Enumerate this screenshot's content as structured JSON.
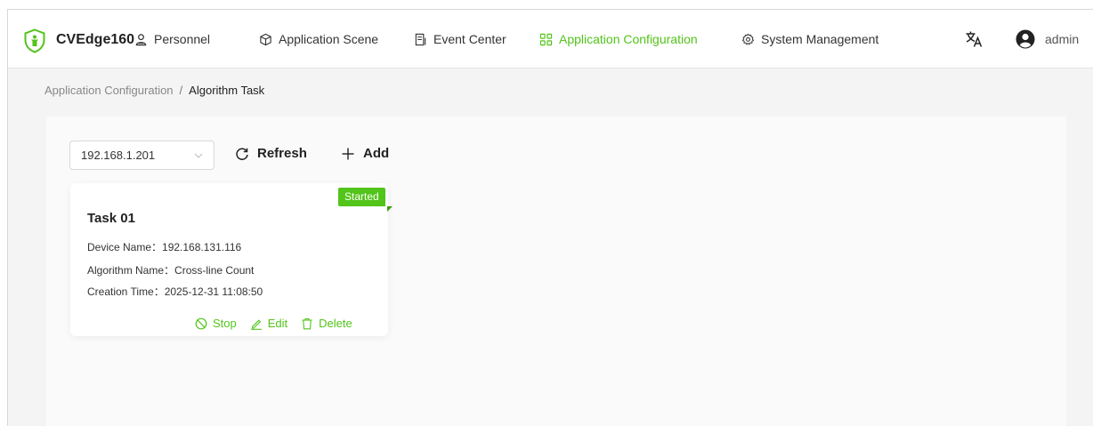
{
  "brand": {
    "name": "CVEdge160",
    "color": "#52c41a"
  },
  "nav": [
    {
      "label": "Personnel",
      "icon": "user-icon"
    },
    {
      "label": "Application Scene",
      "icon": "cube-icon"
    },
    {
      "label": "Event Center",
      "icon": "document-icon"
    },
    {
      "label": "Application Configuration",
      "icon": "grid-icon",
      "active": true
    },
    {
      "label": "System Management",
      "icon": "gear-icon"
    }
  ],
  "header": {
    "language_icon": "translate-icon",
    "user": "admin"
  },
  "breadcrumb": {
    "parent": "Application Configuration",
    "separator": "/",
    "current": "Algorithm Task"
  },
  "toolbar": {
    "device_select": "192.168.1.201",
    "refresh_label": "Refresh",
    "add_label": "Add"
  },
  "task": {
    "status": "Started",
    "title": "Task 01",
    "device_name": "Device Name：192.168.131.116",
    "algorithm_name": "Algorithm Name：Cross-line Count",
    "creation_time": "Creation Time：2025-12-31 11:08:50",
    "stop_label": "Stop",
    "edit_label": "Edit",
    "delete_label": "Delete"
  }
}
